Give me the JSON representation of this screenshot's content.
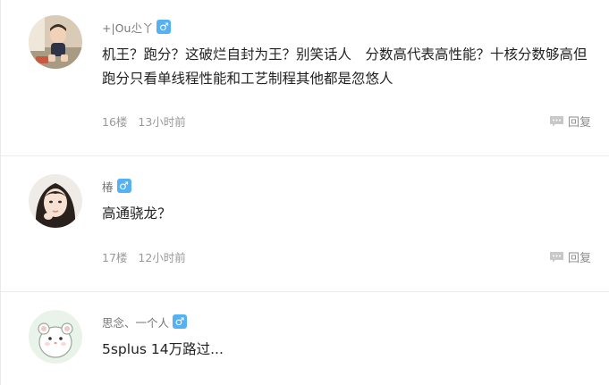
{
  "posts": [
    {
      "username": "+|Ou尐丫",
      "gender_symbol": "♂",
      "content": "机王？跑分？这破烂自封为王？别笑话人　分数高代表高性能？十核分数够高但跑分只看单线程性能和工艺制程其他都是忽悠人",
      "floor": "16楼",
      "time": "13小时前",
      "reply_label": "回复",
      "avatar_icon": "baby-avatar-photo"
    },
    {
      "username": "椿",
      "gender_symbol": "♂",
      "content": "高通骁龙？",
      "floor": "17楼",
      "time": "12小时前",
      "reply_label": "回复",
      "avatar_icon": "woman-avatar-photo"
    },
    {
      "username": "思念、一个人",
      "gender_symbol": "♂",
      "content": "5splus 14万路过...",
      "avatar_icon": "hamster-avatar-illustration"
    }
  ],
  "colors": {
    "gender_badge": "#55b1f2",
    "divider": "#ececec",
    "meta_text": "#999999"
  }
}
